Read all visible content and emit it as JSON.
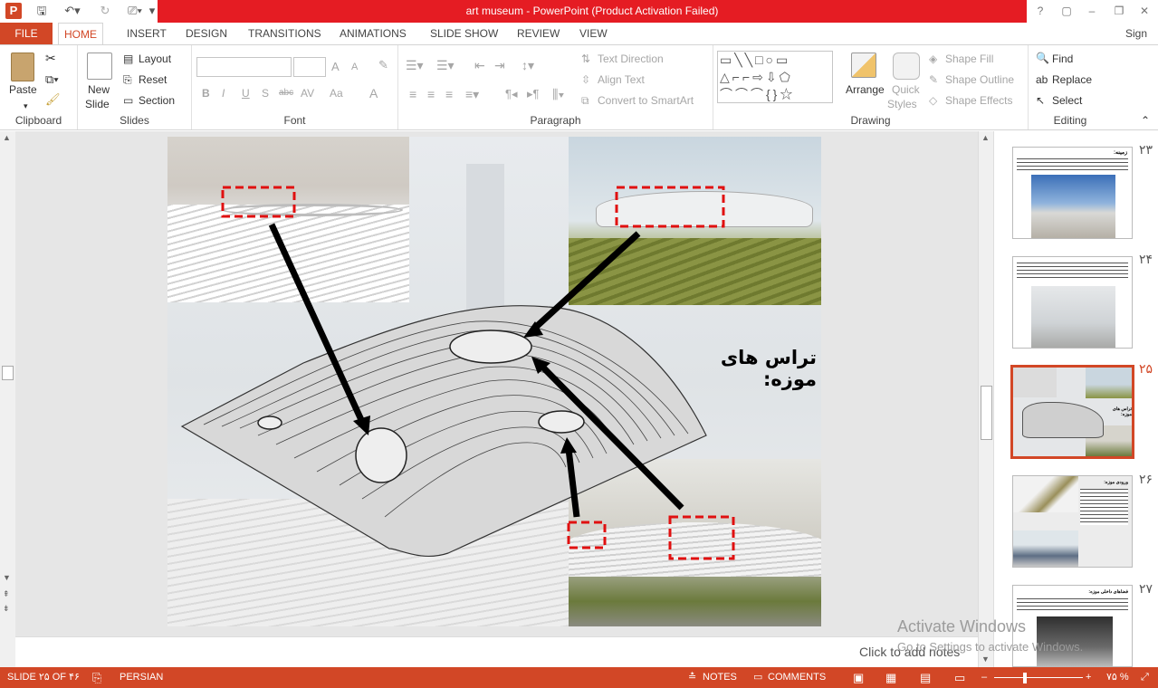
{
  "window": {
    "title": "art museum -  PowerPoint (Product Activation Failed)",
    "controls": [
      "?",
      "▢",
      "–",
      "❐",
      "✕"
    ]
  },
  "account": {
    "sign_in": "Sign in"
  },
  "tabs": [
    "FILE",
    "HOME",
    "INSERT",
    "DESIGN",
    "TRANSITIONS",
    "ANIMATIONS",
    "SLIDE SHOW",
    "REVIEW",
    "VIEW"
  ],
  "ribbon": {
    "clipboard": {
      "label": "Clipboard",
      "paste": "Paste"
    },
    "slides": {
      "label": "Slides",
      "new_slide_1": "New",
      "new_slide_2": "Slide",
      "layout": "Layout",
      "reset": "Reset",
      "section": "Section"
    },
    "font": {
      "label": "Font",
      "bold": "B",
      "italic": "I",
      "underline": "U",
      "shadow": "S",
      "strike": "abc",
      "spacing": "AV",
      "case": "Aa",
      "color": "A",
      "grow": "A",
      "shrink": "A"
    },
    "paragraph": {
      "label": "Paragraph",
      "text_direction": "Text Direction",
      "align_text": "Align Text",
      "smartart": "Convert to SmartArt"
    },
    "drawing": {
      "label": "Drawing",
      "arrange": "Arrange",
      "quick_1": "Quick",
      "quick_2": "Styles",
      "shape_fill": "Shape Fill",
      "shape_outline": "Shape Outline",
      "shape_effects": "Shape Effects"
    },
    "editing": {
      "label": "Editing",
      "find": "Find",
      "replace": "Replace",
      "select": "Select"
    }
  },
  "slide": {
    "title_text": "تراس های موزه:"
  },
  "notes_placeholder": "Click to add notes",
  "thumbnails": [
    {
      "num": "۲۳",
      "selected": false,
      "caption": "زمینه:"
    },
    {
      "num": "۲۴",
      "selected": false,
      "caption": ""
    },
    {
      "num": "۲۵",
      "selected": true,
      "caption": "تراس های موزه:"
    },
    {
      "num": "۲۶",
      "selected": false,
      "caption": "ورودی موزه:"
    },
    {
      "num": "۲۷",
      "selected": false,
      "caption": "فضاهای داخلی موزه:"
    }
  ],
  "watermark": {
    "line1": "Activate Windows",
    "line2": "Go to Settings to activate Windows."
  },
  "status": {
    "slide_counter": "SLIDE ۲۵ OF ۴۶",
    "language": "PERSIAN",
    "notes": "NOTES",
    "comments": "COMMENTS",
    "zoom": "۷۵ %"
  }
}
